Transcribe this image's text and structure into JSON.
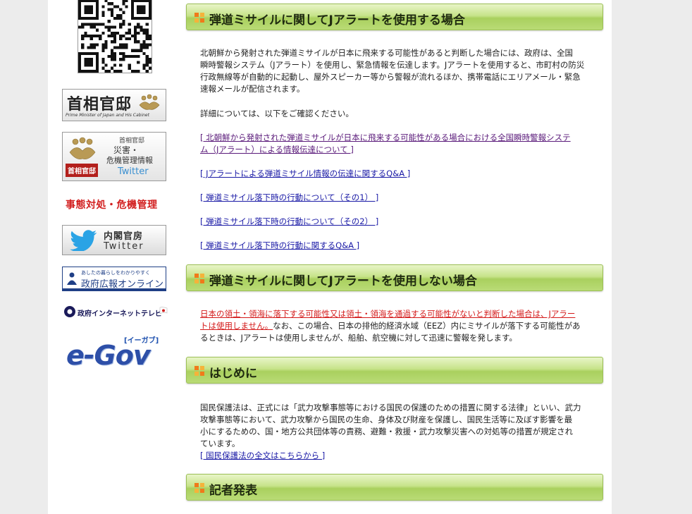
{
  "sidebar": {
    "kantei": {
      "title": "首相官邸",
      "subtitle": "Prime Minister of Japan and His Cabinet"
    },
    "disaster": {
      "line1": "首相官邸",
      "line2": "災害・",
      "line3": "危機管理情報",
      "line4": "Twitter",
      "label": "首相官邸"
    },
    "crisis": "事態対処・危機管理",
    "cabinet_twitter": {
      "line1": "内閣官房",
      "line2": "Twitter"
    },
    "koho": {
      "line1": "あしたの暮らしをわかりやすく",
      "line2": "政府広報オンライン"
    },
    "internet_tv": "政府インターネットテレビ",
    "egov": {
      "logo": "e-Gov",
      "kana": "[イーガブ]"
    },
    "colors": {
      "accent_red": "#d21f1f",
      "koho_blue": "#1f3f86",
      "egov_blue": "#2d4fa8"
    }
  },
  "sections": [
    {
      "title": "弾道ミサイルに関してJアラートを使用する場合",
      "body_lines": [
        "北朝鮮から発射された弾道ミサイルが日本に飛来する可能性があると判断した場合には、政府は、全国",
        "瞬時警報システム（Jアラート）を使用し、緊急情報を伝達します。Jアラートを使用すると、市町村の防災",
        "行政無線等が自動的に起動し、屋外スピーカー等から警報が流れるほか、携帯電話にエリアメール・緊急",
        "速報メールが配信されます。"
      ],
      "detail_intro": "詳細については、以下をご確認ください。",
      "links": [
        {
          "line1": "[ 北朝鮮から発射された弾道ミサイルが日本に飛来する可能性がある場合における全国瞬時警報システ",
          "line2": "ム（Jアラート）による情報伝達について ]"
        },
        {
          "line1": "[ Jアラートによる弾道ミサイル情報の伝達に関するQ&A ]"
        },
        {
          "line1": "[ 弾道ミサイル落下時の行動について（その1） ]"
        },
        {
          "line1": "[ 弾道ミサイル落下時の行動について（その2） ]"
        },
        {
          "line1": "[ 弾道ミサイル落下時の行動に関するQ&A ]"
        }
      ]
    },
    {
      "title": "弾道ミサイルに関してJアラートを使用しない場合",
      "red_line1": "日本の領土・領海に落下する可能性又は領土・領海を通過する可能性がないと判断した場合は、Jアラー",
      "red_line2": "トは使用しません。",
      "rest_line2": "なお、この場合、日本の排他的経済水域（EEZ）内にミサイルが落下する可能性があ",
      "rest_line3": "るときは、Jアラートは使用しませんが、船舶、航空機に対して迅速に警報を発します。"
    },
    {
      "title": "はじめに",
      "body_lines": [
        "国民保護法は、正式には「武力攻撃事態等における国民の保護のための措置に関する法律」といい、武力",
        "攻撃事態等において、武力攻撃から国民の生命、身体及び財産を保護し、国民生活等に及ぼす影響を最",
        "小にするための、国・地方公共団体等の責務、避難・救援・武力攻撃災害への対処等の措置が規定され",
        "ています。"
      ],
      "link": "[ 国民保護法の全文はこちらから ]"
    },
    {
      "title": "記者発表"
    }
  ]
}
